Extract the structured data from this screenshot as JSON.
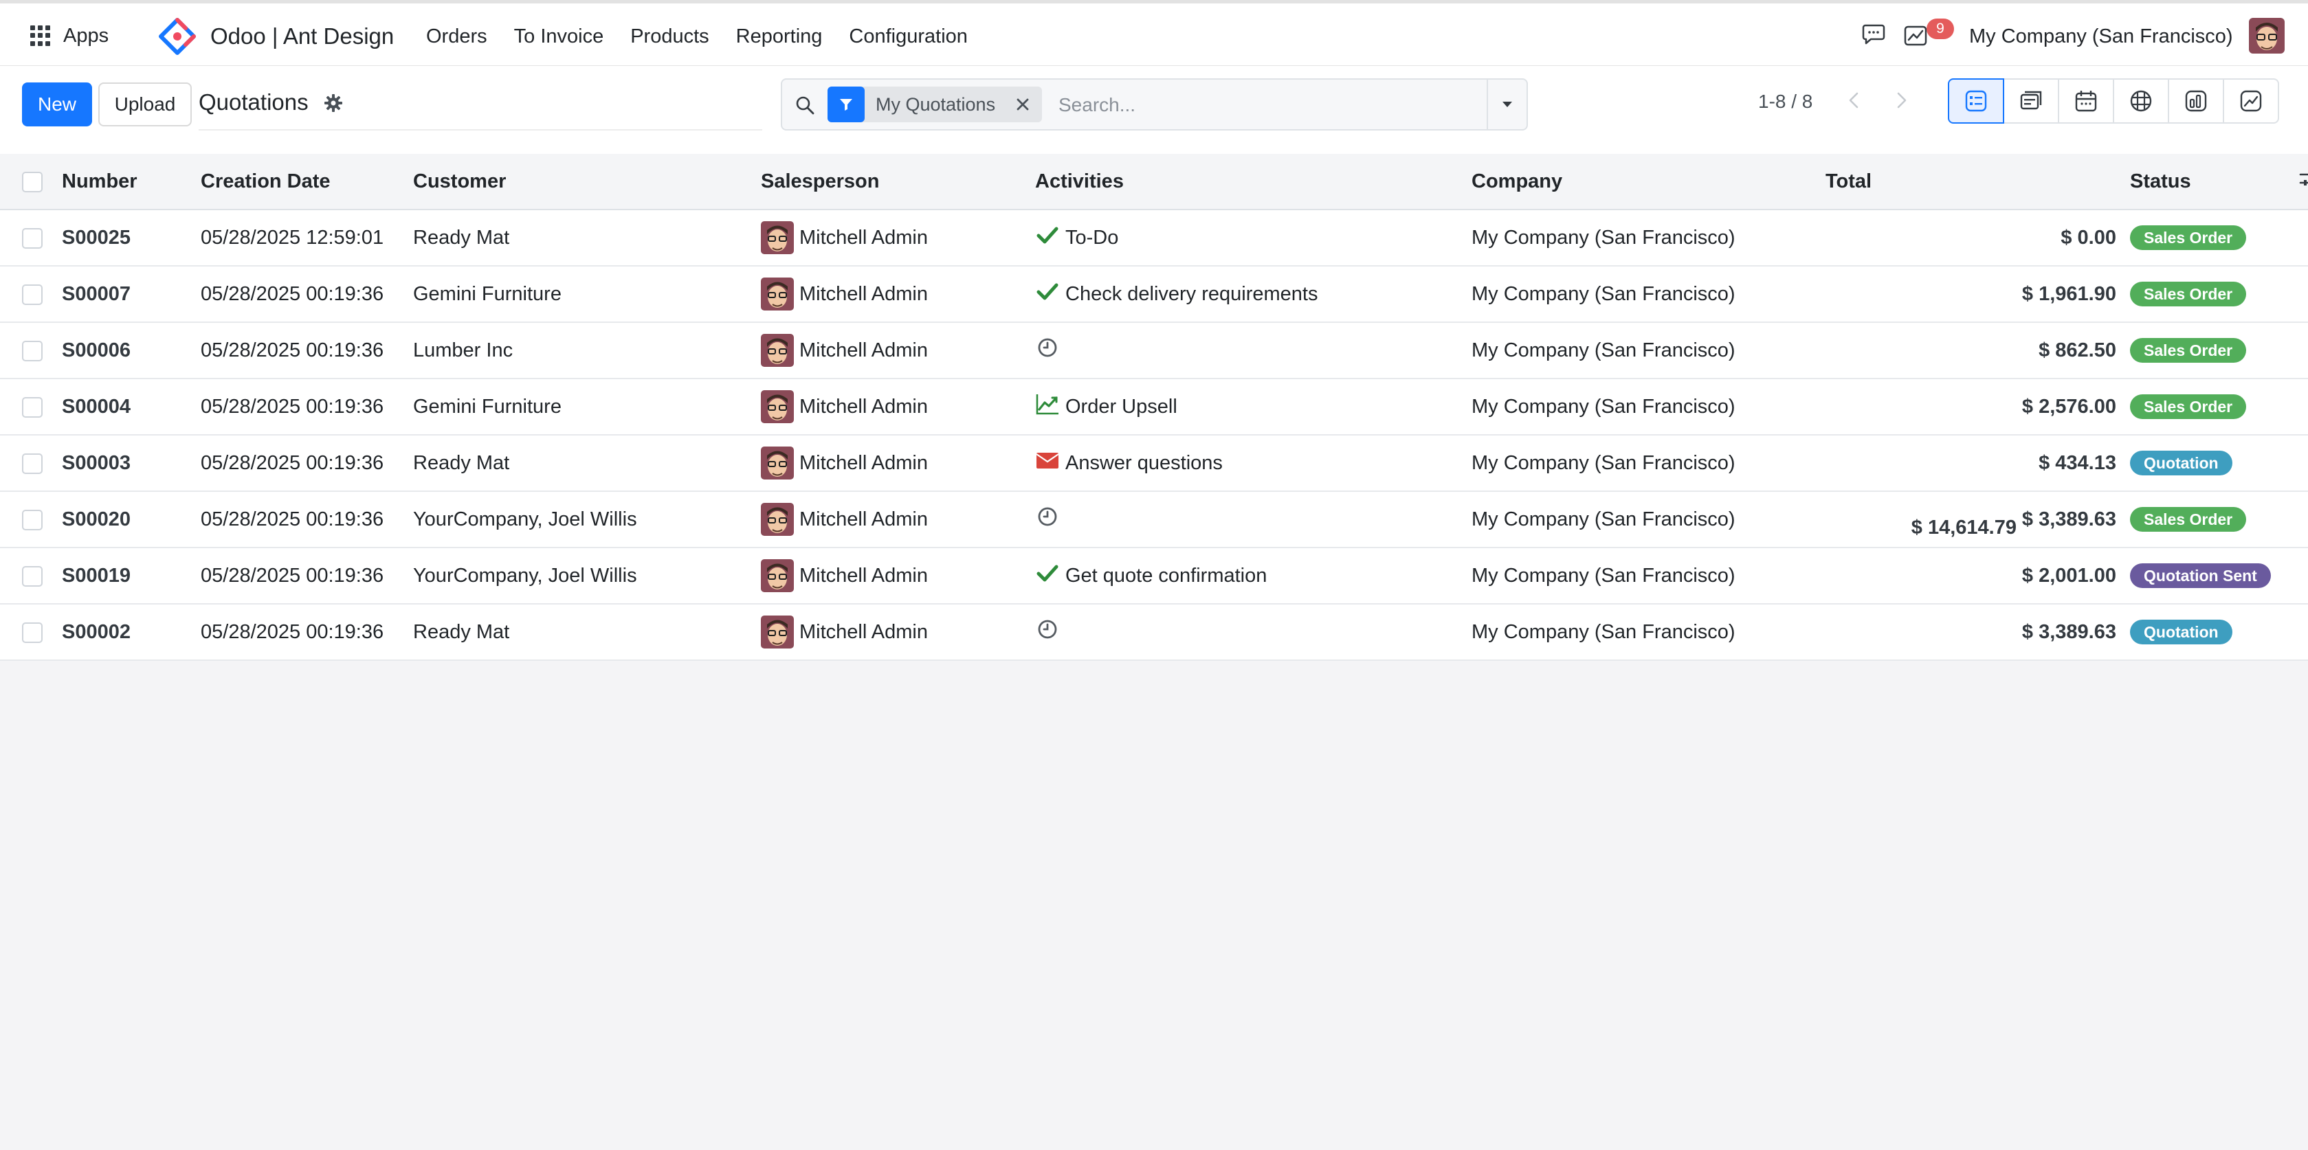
{
  "navbar": {
    "apps_label": "Apps",
    "brand_name": "Odoo | Ant Design",
    "menu": [
      "Orders",
      "To Invoice",
      "Products",
      "Reporting",
      "Configuration"
    ],
    "activity_count": "9",
    "company": "My Company (San Francisco)"
  },
  "control_panel": {
    "new_label": "New",
    "upload_label": "Upload",
    "title": "Quotations",
    "search": {
      "facet_label": "My Quotations",
      "placeholder": "Search..."
    },
    "pager": "1-8 / 8",
    "views": [
      "list-view-icon",
      "kanban-view-icon",
      "calendar-view-icon",
      "pivot-view-icon",
      "graph-view-icon",
      "activity-view-icon"
    ],
    "active_view": "list-view-icon"
  },
  "list": {
    "columns": [
      "Number",
      "Creation Date",
      "Customer",
      "Salesperson",
      "Activities",
      "Company",
      "Total",
      "Status"
    ],
    "rows": [
      {
        "number": "S00025",
        "date": "05/28/2025 12:59:01",
        "customer": "Ready Mat",
        "salesperson": "Mitchell Admin",
        "activity_icon": "check-icon",
        "activity": "To-Do",
        "company": "My Company (San Francisco)",
        "total": "$ 0.00",
        "status": "Sales Order",
        "status_color": "#52ae5a"
      },
      {
        "number": "S00007",
        "date": "05/28/2025 00:19:36",
        "customer": "Gemini Furniture",
        "salesperson": "Mitchell Admin",
        "activity_icon": "check-icon",
        "activity": "Check delivery requirements",
        "company": "My Company (San Francisco)",
        "total": "$ 1,961.90",
        "status": "Sales Order",
        "status_color": "#52ae5a"
      },
      {
        "number": "S00006",
        "date": "05/28/2025 00:19:36",
        "customer": "Lumber Inc",
        "salesperson": "Mitchell Admin",
        "activity_icon": "clock-icon",
        "activity": "",
        "company": "My Company (San Francisco)",
        "total": "$ 862.50",
        "status": "Sales Order",
        "status_color": "#52ae5a"
      },
      {
        "number": "S00004",
        "date": "05/28/2025 00:19:36",
        "customer": "Gemini Furniture",
        "salesperson": "Mitchell Admin",
        "activity_icon": "trend-icon",
        "activity": "Order Upsell",
        "company": "My Company (San Francisco)",
        "total": "$ 2,576.00",
        "status": "Sales Order",
        "status_color": "#52ae5a"
      },
      {
        "number": "S00003",
        "date": "05/28/2025 00:19:36",
        "customer": "Ready Mat",
        "salesperson": "Mitchell Admin",
        "activity_icon": "envelope-icon",
        "activity": "Answer questions",
        "company": "My Company (San Francisco)",
        "total": "$ 434.13",
        "status": "Quotation",
        "status_color": "#3e9ec0"
      },
      {
        "number": "S00020",
        "date": "05/28/2025 00:19:36",
        "customer": "YourCompany, Joel Willis",
        "salesperson": "Mitchell Admin",
        "activity_icon": "clock-icon",
        "activity": "",
        "company": "My Company (San Francisco)",
        "total": "$ 3,389.63",
        "status": "Sales Order",
        "status_color": "#52ae5a"
      },
      {
        "number": "S00019",
        "date": "05/28/2025 00:19:36",
        "customer": "YourCompany, Joel Willis",
        "salesperson": "Mitchell Admin",
        "activity_icon": "check-icon",
        "activity": "Get quote confirmation",
        "company": "My Company (San Francisco)",
        "total": "$ 2,001.00",
        "status": "Quotation Sent",
        "status_color": "#6a5a9e"
      },
      {
        "number": "S00002",
        "date": "05/28/2025 00:19:36",
        "customer": "Ready Mat",
        "salesperson": "Mitchell Admin",
        "activity_icon": "clock-icon",
        "activity": "",
        "company": "My Company (San Francisco)",
        "total": "$ 3,389.63",
        "status": "Quotation",
        "status_color": "#3e9ec0"
      }
    ],
    "grand_total": "$ 14,614.79"
  },
  "colors": {
    "primary": "#1677ff",
    "sales_order": "#52ae5a",
    "quotation": "#3e9ec0",
    "quotation_sent": "#6a5a9e",
    "check": "#2e8b3a",
    "trend": "#2e8b3a",
    "envelope": "#d9443b",
    "badge_red": "#e45b5b"
  }
}
